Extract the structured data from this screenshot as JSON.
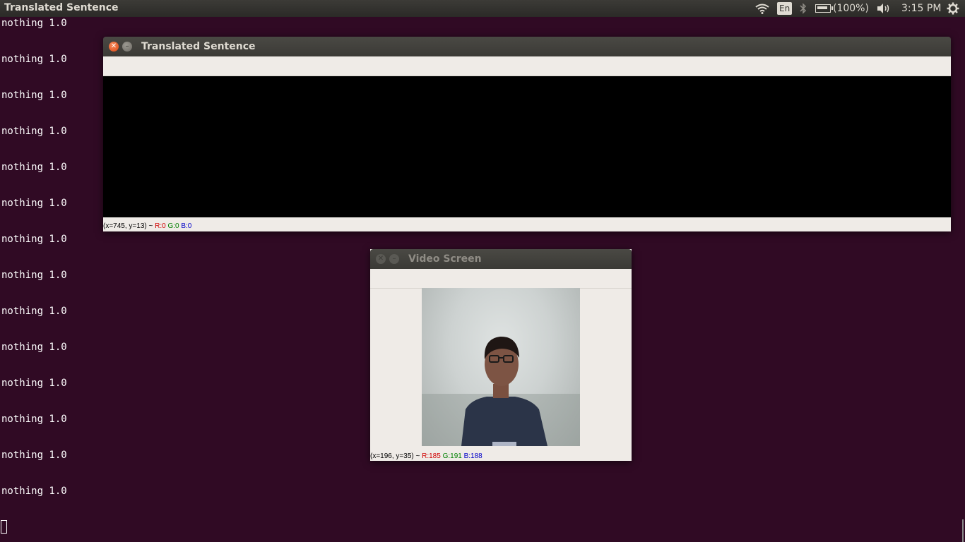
{
  "top_panel": {
    "app_title": "Translated Sentence",
    "language": "En",
    "battery": "(100%)",
    "clock": "3:15 PM",
    "icons": [
      "wifi-icon",
      "bluetooth-icon",
      "battery-icon",
      "volume-icon",
      "settings-gear-icon"
    ]
  },
  "terminal": {
    "lines": [
      "nothing 1.0",
      "nothing 1.0",
      "nothing 1.0",
      "nothing 1.0",
      "nothing 1.0",
      "nothing 1.0",
      "nothing 1.0",
      "nothing 1.0",
      "nothing 1.0",
      "nothing 1.0",
      "nothing 1.0",
      "nothing 1.0",
      "nothing 1.0",
      "nothing 1.0"
    ]
  },
  "translated_window": {
    "title": "Translated Sentence",
    "status_coords": "(x=745, y=13) ~ ",
    "status_r": "R:0",
    "status_g": "G:0",
    "status_b": "B:0"
  },
  "video_window": {
    "title": "Video Screen",
    "status_coords": "(x=196, y=35) ~ ",
    "status_r": "R:185",
    "status_g": "G:191",
    "status_b": "B:188"
  },
  "colors": {
    "desktop_bg": "#300a24",
    "accent_close": "#dd4814",
    "window_bg": "#efebe7"
  }
}
